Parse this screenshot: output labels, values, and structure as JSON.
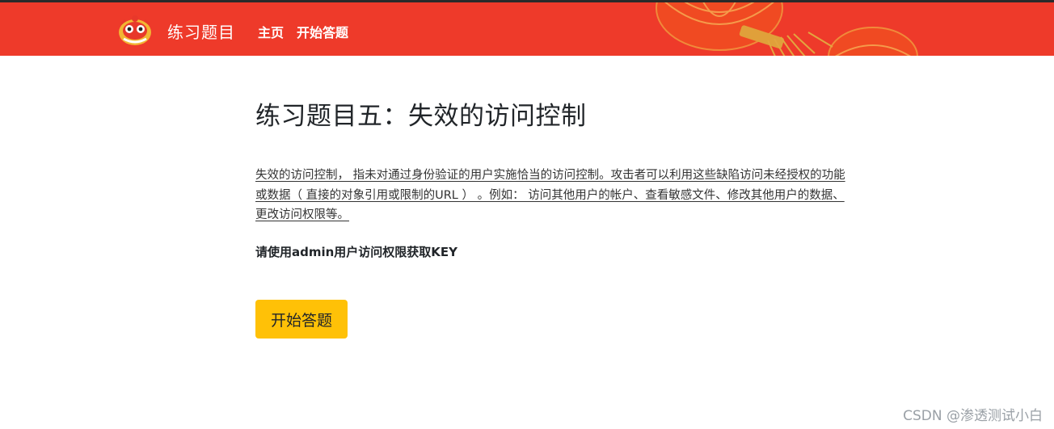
{
  "navbar": {
    "brand": "练习题目",
    "links": [
      {
        "label": "主页"
      },
      {
        "label": "开始答题"
      }
    ],
    "background_color": "#ee3a2a"
  },
  "main": {
    "title": "练习题目五：失效的访问控制",
    "description": "失效的访问控制， 指未对通过身份验证的用户实施恰当的访问控制。攻击者可以利用这些缺陷访问未经授权的功能或数据（ 直接的对象引用或限制的URL ） 。例如： 访问其他用户的帐户、查看敏感文件、修改其他用户的数据、更改访问权限等。",
    "instruction": "请使用admin用户访问权限获取KEY",
    "start_button": "开始答题",
    "button_color": "#ffc107"
  },
  "watermark": "CSDN @渗透测试小白",
  "icons": {
    "brand_logo": "lion-dance-icon",
    "decoration": "lantern-icon"
  }
}
